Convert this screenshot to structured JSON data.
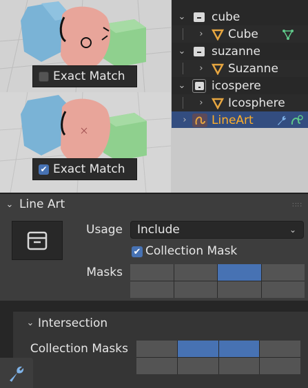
{
  "viewport_top": {
    "toggle": {
      "label": "Exact Match",
      "checked": false
    }
  },
  "viewport_bottom": {
    "toggle": {
      "label": "Exact Match",
      "checked": true,
      "check_glyph": "✔"
    }
  },
  "outliner": {
    "rows": [
      {
        "name": "cube",
        "type": "collection",
        "expanded": true
      },
      {
        "name": "Cube",
        "type": "mesh-object"
      },
      {
        "name": "suzanne",
        "type": "collection",
        "expanded": true
      },
      {
        "name": "Suzanne",
        "type": "mesh-object"
      },
      {
        "name": "icospere",
        "type": "collection",
        "expanded": true
      },
      {
        "name": "Icosphere",
        "type": "mesh-object"
      },
      {
        "name": "LineArt",
        "type": "grease-pencil-object",
        "selected": true
      }
    ],
    "glyphs": {
      "expanded": "⌄",
      "collapsed": "›"
    }
  },
  "line_art_panel": {
    "title": "Line Art",
    "header_chevron": "⌄",
    "grip": "∷∷",
    "usage_label": "Usage",
    "usage_value": "Include",
    "dropdown_chevron": "⌄",
    "collection_mask_label": "Collection Mask",
    "collection_mask_checked": true,
    "check_glyph": "✔",
    "masks_label": "Masks",
    "masks": [
      false,
      false,
      true,
      false,
      false,
      false,
      false,
      false
    ]
  },
  "intersection_panel": {
    "title": "Intersection",
    "header_chevron": "⌄",
    "collection_masks_label": "Collection Masks",
    "masks": [
      false,
      true,
      true,
      false,
      false,
      false,
      false,
      false
    ]
  },
  "colors": {
    "accent": "#4772b3",
    "selected_row": "#334d80",
    "selected_text": "#ffaf29",
    "panel_bg": "#3d3d3d",
    "mesh_icon": "#e7a640"
  },
  "icons": [
    "collection-icon",
    "mesh-icon",
    "lineart-icon",
    "wrench-icon",
    "modifier-icon"
  ]
}
